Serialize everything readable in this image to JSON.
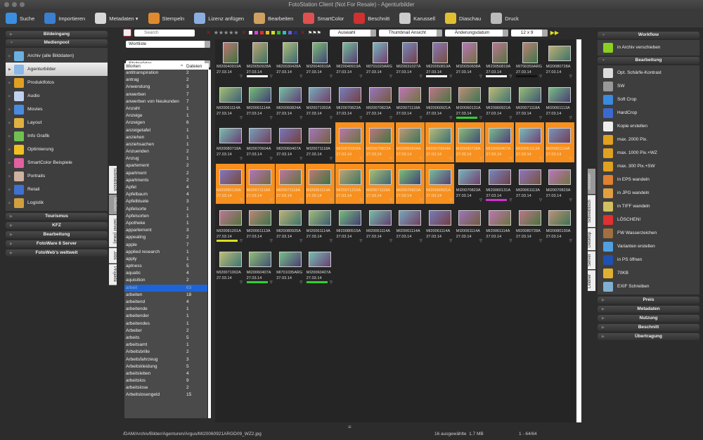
{
  "window": {
    "title": "FotoStation Client (Not For Resale) - Agenturbilder"
  },
  "toolbar": [
    {
      "label": "Suche",
      "icon": "magnifier-icon",
      "color": "#3a8fe0"
    },
    {
      "label": "Importieren",
      "icon": "import-icon",
      "color": "#3a7fd0"
    },
    {
      "label": "Metadaten ▾",
      "icon": "metadata-icon",
      "color": "#d8d8d8"
    },
    {
      "label": "Stempeln",
      "icon": "stamp-icon",
      "color": "#e08a30"
    },
    {
      "label": "Lizenz anfügen",
      "icon": "license-icon",
      "color": "#8aaee0"
    },
    {
      "label": "Bearbeiten",
      "icon": "palette-icon",
      "color": "#d0a060"
    },
    {
      "label": "SmartColor",
      "icon": "smartcolor-icon",
      "color": "#e05050"
    },
    {
      "label": "Beschnitt",
      "icon": "scissors-icon",
      "color": "#d03030"
    },
    {
      "label": "Karussell",
      "icon": "carousel-icon",
      "color": "#cccccc"
    },
    {
      "label": "Diaschau",
      "icon": "slideshow-icon",
      "color": "#e0c030"
    },
    {
      "label": "Druck",
      "icon": "printer-icon",
      "color": "#bbbbbb"
    }
  ],
  "filterbar": {
    "search_placeholder": "Search",
    "label_colors": [
      "#ffffff",
      "#e040e0",
      "#e03030",
      "#e0c020",
      "#d0e020",
      "#30c030",
      "#30c0c0",
      "#6060e0",
      "#303090"
    ],
    "auswahl": "Auswahl",
    "view": "Thumbnail Ansicht",
    "sort": "Änderungsdatum",
    "grid": "12 x 9"
  },
  "left": {
    "sections_top": [
      "Bildeingang"
    ],
    "open_section": "Medienpool",
    "items": [
      {
        "label": "Archiv (alle Bilddaten)",
        "color": "#6ab0e0"
      },
      {
        "label": "Agenturbilder",
        "color": "#8ab8e8",
        "selected": true
      },
      {
        "label": "Produktfotos",
        "color": "#e0a020"
      },
      {
        "label": "Audio",
        "color": "#c0d0f0"
      },
      {
        "label": "Movies",
        "color": "#4a8ae0"
      },
      {
        "label": "Layout",
        "color": "#e0b040"
      },
      {
        "label": "Info Grafik",
        "color": "#70c050"
      },
      {
        "label": "Optimierung",
        "color": "#f0c020"
      },
      {
        "label": "SmartColor Beispiele",
        "color": "#e060a0"
      },
      {
        "label": "Portraits",
        "color": "#d0b0a0"
      },
      {
        "label": "Retail",
        "color": "#4070d0"
      },
      {
        "label": "Logistik",
        "color": "#d0a040"
      }
    ],
    "sections_bottom": [
      "Tourismus",
      "KFZ",
      "Bearbeitung",
      "FotoWare 8 Server",
      "FotoWeb's weltweit"
    ]
  },
  "left_tabs": [
    {
      "label": "Schreibtisch"
    },
    {
      "label": "Medien",
      "selected": true
    },
    {
      "label": "Server (lokal)"
    },
    {
      "label": "Jobs"
    },
    {
      "label": "Projekte"
    }
  ],
  "wordlist": {
    "mode": "Wortliste",
    "field": "Stichwörter",
    "col_word": "Worten",
    "col_files": "Dateien",
    "rows": [
      [
        "antitranspiration",
        "2"
      ],
      [
        "antrag",
        "2"
      ],
      [
        "Anwendung",
        "3"
      ],
      [
        "anwerben",
        "7"
      ],
      [
        "anwerben von Neukunden",
        "7"
      ],
      [
        "Anzahl",
        "1"
      ],
      [
        "Anzeige",
        "1"
      ],
      [
        "Anzeigen",
        "6"
      ],
      [
        "anzeigetafel",
        "1"
      ],
      [
        "anziehen",
        "1"
      ],
      [
        "anziehsachen",
        "1"
      ],
      [
        "Anzuenden",
        "2"
      ],
      [
        "Anzug",
        "1"
      ],
      [
        "apartement",
        "2"
      ],
      [
        "apartment",
        "2"
      ],
      [
        "apartments",
        "2"
      ],
      [
        "Apfel",
        "4"
      ],
      [
        "Apfelbaum",
        "4"
      ],
      [
        "Apfelbluete",
        "3"
      ],
      [
        "Apfelsorte",
        "1"
      ],
      [
        "Apfelsorten",
        "1"
      ],
      [
        "Apotheke",
        "1"
      ],
      [
        "appartement",
        "3"
      ],
      [
        "appealing",
        "2"
      ],
      [
        "apple",
        "7"
      ],
      [
        "applied research",
        "1"
      ],
      [
        "apply",
        "1"
      ],
      [
        "aptness",
        "5"
      ],
      [
        "aquatic",
        "4"
      ],
      [
        "aquisition",
        "2"
      ],
      [
        "arbeit",
        "63"
      ],
      [
        "arbeiten",
        "18"
      ],
      [
        "arbeitend",
        "4"
      ],
      [
        "arbeitende",
        "1"
      ],
      [
        "arbeitender",
        "1"
      ],
      [
        "arbeitendes",
        "1"
      ],
      [
        "Arbeiter",
        "2"
      ],
      [
        "arbeits",
        "5"
      ],
      [
        "arbeitsamt",
        "1"
      ],
      [
        "Arbeitsbrille",
        "2"
      ],
      [
        "Arbeitsfahrzeug",
        "3"
      ],
      [
        "Arbeitskleidung",
        "5"
      ],
      [
        "arbeitsleben",
        "4"
      ],
      [
        "arbeitslos",
        "9"
      ],
      [
        "arbeitslose",
        "2"
      ],
      [
        "Arbeitslosengeld",
        "15"
      ]
    ],
    "selected_index": 30
  },
  "thumbnails": {
    "date": "27.03.14",
    "items": [
      {
        "n": "MI20040919A"
      },
      {
        "n": "MI20050928A",
        "bar": "#ffffff"
      },
      {
        "n": "MI20030428A"
      },
      {
        "n": "MI20040919A"
      },
      {
        "n": "MI20040919A"
      },
      {
        "n": "MI701020ARG"
      },
      {
        "n": "MI20031027A"
      },
      {
        "n": "MI20050819A",
        "bar": "#ffffff"
      },
      {
        "n": "MI20050608A"
      },
      {
        "n": "MI20050819A",
        "bar": "#ffffff"
      },
      {
        "n": "MI700359ARG",
        "bar": "#111111"
      },
      {
        "n": "MI20080728A"
      },
      {
        "n": "MI20061114A"
      },
      {
        "n": "MI20061114A"
      },
      {
        "n": "MI20060824A"
      },
      {
        "n": "MI20071002A"
      },
      {
        "n": "MI20070823A"
      },
      {
        "n": "MI20070823A"
      },
      {
        "n": "MI20071118A"
      },
      {
        "n": "MI20060921A"
      },
      {
        "n": "MI20060131A",
        "bar": "#30d030"
      },
      {
        "n": "MI20060921A"
      },
      {
        "n": "MI20071118A"
      },
      {
        "n": "MI20061113A"
      },
      {
        "n": "MI20080718A"
      },
      {
        "n": "MI20070604A"
      },
      {
        "n": "MI20060407A"
      },
      {
        "n": "MI20071118A"
      },
      {
        "n": "MI20070306A",
        "s": true
      },
      {
        "n": "MI20070823A",
        "s": true
      },
      {
        "n": "MI20060824A",
        "s": true
      },
      {
        "n": "MI20070604A",
        "s": true
      },
      {
        "n": "MI20080728A",
        "s": true
      },
      {
        "n": "MI20060407A",
        "s": true
      },
      {
        "n": "MI20061113A",
        "s": true
      },
      {
        "n": "MI20061114A",
        "s": true
      },
      {
        "n": "MI20080130A",
        "s": true
      },
      {
        "n": "MI20071118A",
        "s": true
      },
      {
        "n": "MI20071118A",
        "s": true
      },
      {
        "n": "MI20061114A",
        "s": true
      },
      {
        "n": "MI20071215A",
        "s": true
      },
      {
        "n": "MI20071118A",
        "s": true
      },
      {
        "n": "MI20070823A",
        "s": true
      },
      {
        "n": "MI20060921A",
        "s": true
      },
      {
        "n": "MI20070823A"
      },
      {
        "n": "MI20060131A",
        "bar": "#d030d0"
      },
      {
        "n": "MI20061113A"
      },
      {
        "n": "MI20070823A"
      },
      {
        "n": "MI20081201A",
        "bar": "#d8e020"
      },
      {
        "n": "MI20061113A"
      },
      {
        "n": "MI20080925A"
      },
      {
        "n": "MI20061114A"
      },
      {
        "n": "MI20080515A"
      },
      {
        "n": "MI20061114A"
      },
      {
        "n": "MI20061114A"
      },
      {
        "n": "MI20061114A"
      },
      {
        "n": "MI20061114A"
      },
      {
        "n": "MI20061114A"
      },
      {
        "n": "MI20080728A"
      },
      {
        "n": "MI20080130A"
      },
      {
        "n": "MI20071002A"
      },
      {
        "n": "MI20060407A",
        "bar": "#30d030"
      },
      {
        "n": "MI701035ARG"
      },
      {
        "n": "MI20060407A",
        "bar": "#30d030"
      }
    ]
  },
  "right_tabs": [
    {
      "label": "Aktionen",
      "selected": true
    },
    {
      "label": "Schreibtisch"
    },
    {
      "label": "Desktop"
    },
    {
      "label": "Server"
    },
    {
      "label": "Lindner"
    }
  ],
  "right": {
    "workflow": {
      "title": "Workflow",
      "items": [
        {
          "label": "in Archiv verschieben",
          "color": "#8ad020"
        }
      ]
    },
    "bearbeitung": {
      "title": "Bearbeitung",
      "items": [
        {
          "label": "Opt. Schärfe-Kontrast",
          "color": "#dddddd"
        },
        {
          "label": "SW",
          "color": "#999999"
        },
        {
          "label": "Soft Crop",
          "color": "#3a8ae0"
        },
        {
          "label": "HardCrop",
          "color": "#3a6ad0"
        },
        {
          "label": "Kopie erstellen",
          "color": "#eeeeee"
        },
        {
          "label": "max. 2000 Pix.",
          "color": "#e0a020"
        },
        {
          "label": "max. 1000 Pix.+WZ",
          "color": "#e0a020"
        },
        {
          "label": "max. 300 Pix.+SW",
          "color": "#e0a020"
        },
        {
          "label": "in EPS wandeln",
          "color": "#e08030"
        },
        {
          "label": "in JPG wandeln",
          "color": "#e0a040"
        },
        {
          "label": "in TIFF wandeln",
          "color": "#d0c060"
        },
        {
          "label": "LÖSCHEN!",
          "color": "#e03030"
        },
        {
          "label": "FW Wasserzeichen",
          "color": "#a07040"
        },
        {
          "label": "Varianten erstellen",
          "color": "#50a0e0"
        },
        {
          "label": "in PS öffnen",
          "color": "#2050b0"
        },
        {
          "label": "70KB",
          "color": "#e0b030"
        },
        {
          "label": "EXIF Schreiben",
          "color": "#80b0d0"
        }
      ]
    },
    "sections_bottom": [
      "Preis",
      "Metadaten",
      "Nutzung",
      "Beschnitt",
      "Übertragung"
    ]
  },
  "status": {
    "path": "/DAM/Archiv/Bilder/Agenturen/Argus/MI20060921ARGD09_WZ2.jpg",
    "selection": "16 ausgewählte  1.7 MB",
    "range": "1 - 64/64"
  }
}
